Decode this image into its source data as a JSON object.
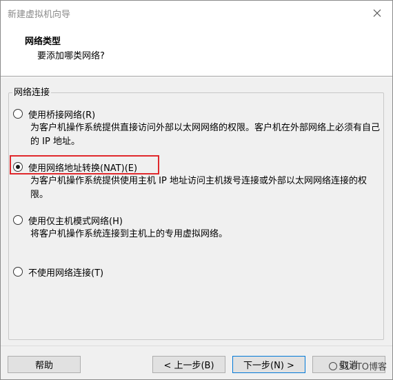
{
  "window": {
    "title": "新建虚拟机向导"
  },
  "header": {
    "title": "网络类型",
    "subtitle": "要添加哪类网络?"
  },
  "group": {
    "label": "网络连接",
    "options": [
      {
        "label": "使用桥接网络(R)",
        "description": "为客户机操作系统提供直接访问外部以太网网络的权限。客户机在外部网络上必须有自己的 IP 地址。",
        "checked": false
      },
      {
        "label": "使用网络地址转换(NAT)(E)",
        "description": "为客户机操作系统提供使用主机 IP 地址访问主机拨号连接或外部以太网网络连接的权限。",
        "checked": true
      },
      {
        "label": "使用仅主机模式网络(H)",
        "description": "将客户机操作系统连接到主机上的专用虚拟网络。",
        "checked": false
      },
      {
        "label": "不使用网络连接(T)",
        "description": "",
        "checked": false
      }
    ],
    "highlight_color": "#e0272b"
  },
  "footer": {
    "help_label": "帮助",
    "back_label": "< 上一步(B)",
    "next_label": "下一步(N) >",
    "cancel_label": "取消"
  },
  "watermark": {
    "text": "51CTO博客"
  }
}
